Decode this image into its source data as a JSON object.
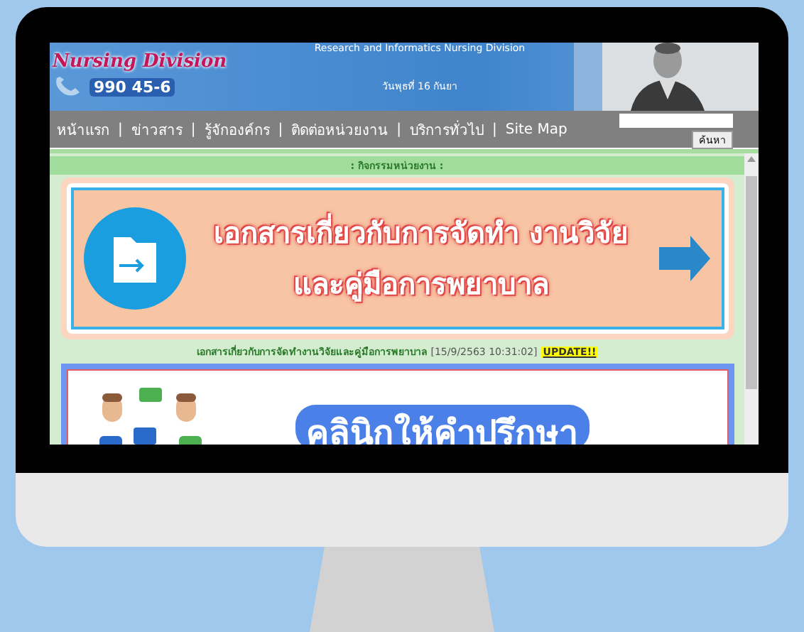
{
  "header": {
    "title": "Research and Informatics Nursing Division",
    "logo": "Nursing Division",
    "phone": "990 45-6",
    "date": "วันพุธที่ 16 กันยา"
  },
  "nav": {
    "separator": "|",
    "items": [
      {
        "label": "หน้าแรก"
      },
      {
        "label": "ข่าวสาร"
      },
      {
        "label": "รู้จักองค์กร"
      },
      {
        "label": "ติดต่อหน่วยงาน"
      },
      {
        "label": "บริการทั่วไป"
      },
      {
        "label": "Site Map"
      }
    ]
  },
  "search": {
    "button": "ค้นหา"
  },
  "section_title": ": กิจกรรมหน่วยงาน :",
  "banner": {
    "lines": [
      "เอกสารเกี่ยวกับการจัดทำ งานวิจัย",
      "และคู่มือการพยาบาล"
    ]
  },
  "news": {
    "link": "เอกสารเกี่ยวกับการจัดทำงานวิจัยและคู่มือการพยาบาล",
    "timestamp": "[15/9/2563 10:31:02]",
    "badge": "UPDATE!!"
  },
  "banner2": {
    "title": "คลินิกให้คำปรึกษา"
  }
}
